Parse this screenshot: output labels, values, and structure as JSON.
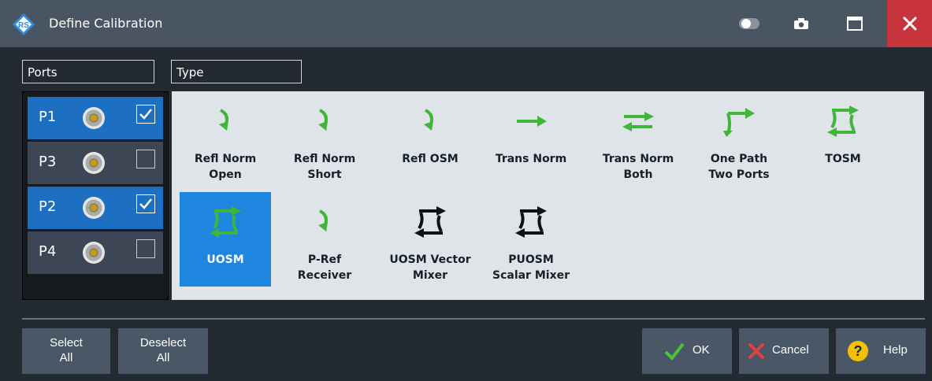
{
  "window": {
    "title": "Define Calibration",
    "title_buttons": [
      "toggle-icon",
      "camera-icon",
      "maximize-icon",
      "close-icon"
    ]
  },
  "ports": {
    "label": "Ports",
    "items": [
      {
        "name": "P1",
        "checked": true
      },
      {
        "name": "P3",
        "checked": false
      },
      {
        "name": "P2",
        "checked": true
      },
      {
        "name": "P4",
        "checked": false
      }
    ]
  },
  "types": {
    "label": "Type",
    "items": [
      {
        "line1": "Refl Norm",
        "line2": "Open",
        "icon": "refl-icon",
        "selected": false
      },
      {
        "line1": "Refl Norm",
        "line2": "Short",
        "icon": "refl-icon",
        "selected": false
      },
      {
        "line1": "Refl OSM",
        "line2": "",
        "icon": "refl-icon",
        "selected": false
      },
      {
        "line1": "Trans Norm",
        "line2": "",
        "icon": "trans-arrow-icon",
        "selected": false
      },
      {
        "line1": "Trans Norm",
        "line2": "Both",
        "icon": "trans-both-icon",
        "selected": false
      },
      {
        "line1": "One Path",
        "line2": "Two Ports",
        "icon": "one-path-icon",
        "selected": false
      },
      {
        "line1": "TOSM",
        "line2": "",
        "icon": "tosm-icon",
        "selected": false
      },
      {
        "line1": "UOSM",
        "line2": "",
        "icon": "tosm-icon",
        "selected": true
      },
      {
        "line1": "P-Ref",
        "line2": "Receiver",
        "icon": "refl-icon",
        "selected": false
      },
      {
        "line1": "UOSM Vector",
        "line2": "Mixer",
        "icon": "mixer-icon",
        "selected": false
      },
      {
        "line1": "PUOSM",
        "line2": "Scalar Mixer",
        "icon": "mixer-icon",
        "selected": false
      }
    ]
  },
  "buttons": {
    "select_all_1": "Select",
    "select_all_2": "All",
    "deselect_all_1": "Deselect",
    "deselect_all_2": "All",
    "ok": "OK",
    "cancel": "Cancel",
    "help": "Help"
  },
  "colors": {
    "accent": "#1d6fc1",
    "selected_tile": "#1f86e0",
    "icon_green": "#3fb53a",
    "close_red": "#c8343b"
  }
}
